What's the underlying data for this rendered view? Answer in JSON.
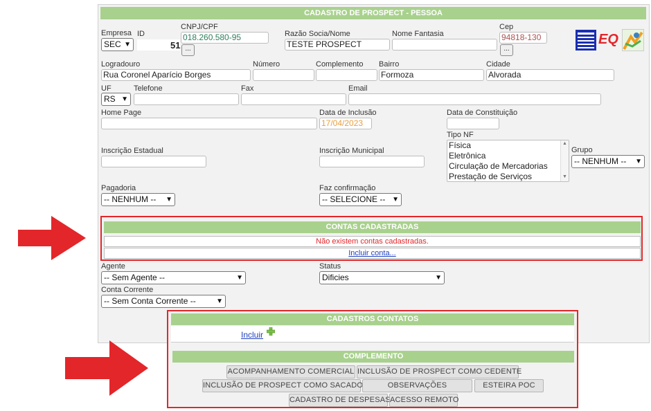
{
  "header": {
    "title": "CADASTRO DE PROSPECT - PESSOA"
  },
  "fields": {
    "empresa": {
      "label": "Empresa",
      "value": "SEC"
    },
    "id": {
      "label": "ID",
      "value": "51"
    },
    "cnpj": {
      "label": "CNPJ/CPF",
      "value": "018.260.580-95",
      "button": "..."
    },
    "razao": {
      "label": "Razão Socia/Nome",
      "value": "TESTE PROSPECT"
    },
    "fantasia": {
      "label": "Nome Fantasia",
      "value": ""
    },
    "cep": {
      "label": "Cep",
      "value": "94818-130",
      "button": "..."
    },
    "logradouro": {
      "label": "Logradouro",
      "value": "Rua Coronel Aparício Borges"
    },
    "numero": {
      "label": "Número",
      "value": ""
    },
    "complemento": {
      "label": "Complemento",
      "value": ""
    },
    "bairro": {
      "label": "Bairro",
      "value": "Formoza"
    },
    "cidade": {
      "label": "Cidade",
      "value": "Alvorada"
    },
    "uf": {
      "label": "UF",
      "value": "RS"
    },
    "telefone": {
      "label": "Telefone",
      "value": ""
    },
    "fax": {
      "label": "Fax",
      "value": ""
    },
    "email": {
      "label": "Email",
      "value": ""
    },
    "homepage": {
      "label": "Home Page",
      "value": ""
    },
    "data_inclusao": {
      "label": "Data de Inclusão",
      "value": "17/04/2023"
    },
    "data_constituicao": {
      "label": "Data de Constituição",
      "value": ""
    },
    "tipo_nf": {
      "label": "Tipo NF",
      "options": [
        "Física",
        "Eletrônica",
        "Circulação de Mercadorias",
        "Prestação de Serviços"
      ]
    },
    "inscricao_estadual": {
      "label": "Inscrição Estadual",
      "value": ""
    },
    "inscricao_municipal": {
      "label": "Inscrição Municipal",
      "value": ""
    },
    "grupo": {
      "label": "Grupo",
      "value": "-- NENHUM --"
    },
    "pagadoria": {
      "label": "Pagadoria",
      "value": "-- NENHUM --"
    },
    "faz_confirmacao": {
      "label": "Faz confirmação",
      "value": "-- SELECIONE --"
    },
    "agente": {
      "label": "Agente",
      "value": "-- Sem Agente --"
    },
    "status": {
      "label": "Status",
      "value": "Dificies"
    },
    "conta_corrente": {
      "label": "Conta Corrente",
      "value": "-- Sem Conta Corrente --"
    }
  },
  "logos": {
    "eq": "EQ"
  },
  "contas": {
    "title": "CONTAS CADASTRADAS",
    "empty_message": "Não existem contas cadastradas.",
    "include_link": "Incluir conta..."
  },
  "contatos": {
    "title": "CADASTROS CONTATOS",
    "include_link": "Incluir"
  },
  "complemento": {
    "title": "COMPLEMENTO",
    "buttons": {
      "acompanhamento": "ACOMPANHAMENTO COMERCIAL",
      "cedente": "INCLUSÃO DE PROSPECT COMO CEDENTE",
      "sacado": "INCLUSÃO DE PROSPECT COMO SACADO",
      "observacoes": "OBSERVAÇÕES",
      "esteira": "ESTEIRA POC",
      "despesas": "CADASTRO DE DESPESAS",
      "acesso": "ACESSO REMOTO"
    }
  },
  "colors": {
    "header_green": "#a9d18e",
    "highlight_red": "#e3262a",
    "error_text": "#e3262a"
  },
  "icons": [
    "dropdown-chevron-icon",
    "plus-icon",
    "right-arrow-icon"
  ]
}
